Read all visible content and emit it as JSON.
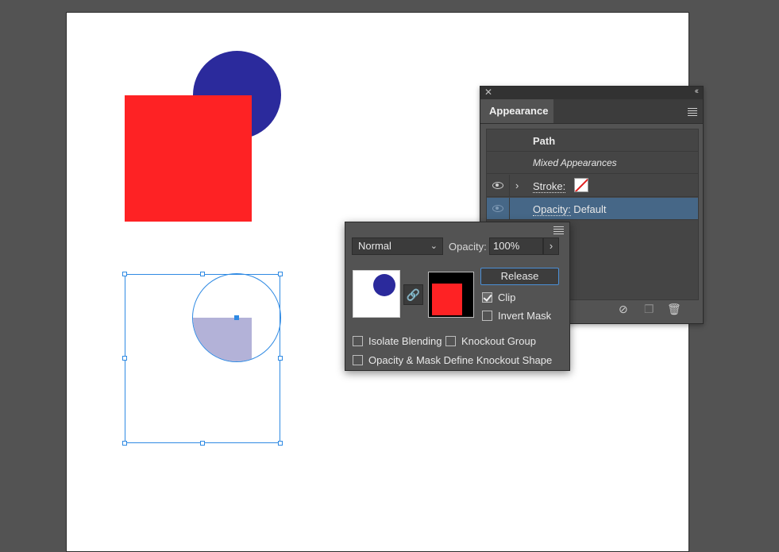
{
  "appearance": {
    "title": "Appearance",
    "rows": [
      {
        "label": "Path"
      },
      {
        "label": "Mixed Appearances"
      },
      {
        "label": "Stroke:"
      },
      {
        "label": "Opacity:",
        "value": " Default"
      }
    ],
    "icons": [
      "close-icon",
      "collapse-icon",
      "panel-menu-icon",
      "eye-icon",
      "chevron-right-icon",
      "clear-appearance-icon",
      "duplicate-item-icon",
      "delete-icon"
    ]
  },
  "transparency": {
    "blend_mode": "Normal",
    "opacity_label": "Opacity:",
    "opacity_value": "100%",
    "release_label": "Release",
    "clip_label": "Clip",
    "clip_checked": true,
    "invert_label": "Invert Mask",
    "invert_checked": false,
    "isolate_label": "Isolate Blending",
    "knockout_label": "Knockout Group",
    "define_label": "Opacity & Mask Define Knockout Shape"
  },
  "colors": {
    "red": "#fe2224",
    "blue": "#2b2a9c",
    "selection": "#2f8ae3",
    "masked_fill": "#b3b2d8",
    "panel_bg": "#535353",
    "selected_row": "#466787"
  }
}
